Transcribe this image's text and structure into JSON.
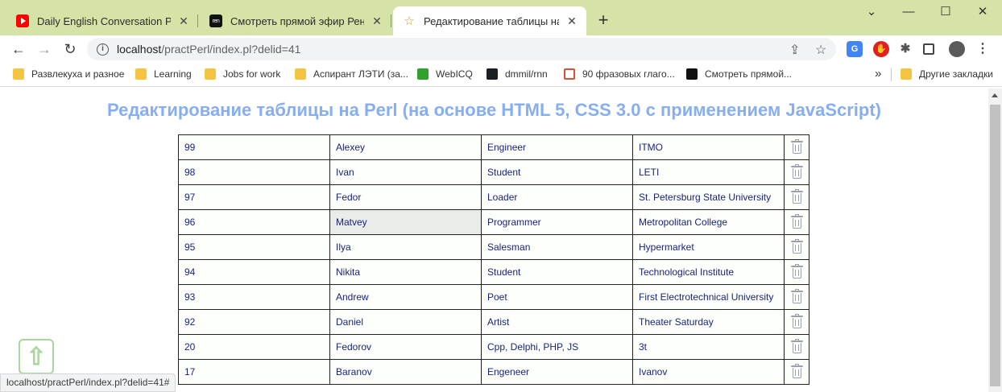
{
  "browser": {
    "tabs": [
      {
        "title": "Daily English Conversation Practice",
        "favicon": "youtube-icon",
        "active": false
      },
      {
        "title": "Смотреть прямой эфир РенТВ онлайн",
        "favicon": "rentv-icon",
        "favicon_text": "ren",
        "active": false
      },
      {
        "title": "Редактирование таблицы на Perl",
        "favicon": "star-icon",
        "active": true
      }
    ],
    "window_controls": {
      "chevron": "⌄",
      "minimize": "—",
      "maximize": "☐",
      "close": "✕"
    },
    "url": {
      "host": "localhost",
      "path": "/practPerl/index.pl?delid=41"
    },
    "bookmarks": [
      {
        "label": "Развлекуха и разное",
        "icon": "folder-icon"
      },
      {
        "label": "Learning",
        "icon": "folder-icon"
      },
      {
        "label": "Jobs for work",
        "icon": "folder-icon"
      },
      {
        "label": "Аспирант ЛЭТИ (за...",
        "icon": "folder-icon"
      },
      {
        "label": "WebICQ",
        "icon": "icq-icon"
      },
      {
        "label": "dmmil/rnn",
        "icon": "github-icon"
      },
      {
        "label": "90 фразовых глаго...",
        "icon": "phrasal-verbs-icon"
      },
      {
        "label": "Смотреть прямой...",
        "icon": "rentv-icon"
      }
    ],
    "bookmarks_more": "»",
    "other_bookmarks": "Другие закладки",
    "status_url": "localhost/practPerl/index.pl?delid=41#"
  },
  "page": {
    "title": "Редактирование таблицы на Perl (на основе HTML 5, CSS 3.0 с применением JavaScript)",
    "rows": [
      {
        "id": "99",
        "name": "Alexey",
        "job": "Engineer",
        "place": "ITMO"
      },
      {
        "id": "98",
        "name": "Ivan",
        "job": "Student",
        "place": "LETI"
      },
      {
        "id": "97",
        "name": "Fedor",
        "job": "Loader",
        "place": "St. Petersburg State University"
      },
      {
        "id": "96",
        "name": "Matvey",
        "job": "Programmer",
        "place": "Metropolitan College"
      },
      {
        "id": "95",
        "name": "Ilya",
        "job": "Salesman",
        "place": "Hypermarket"
      },
      {
        "id": "94",
        "name": "Nikita",
        "job": "Student",
        "place": "Technological Institute"
      },
      {
        "id": "93",
        "name": "Andrew",
        "job": "Poet",
        "place": "First Electrotechnical University"
      },
      {
        "id": "92",
        "name": "Daniel",
        "job": "Artist",
        "place": "Theater Saturday"
      },
      {
        "id": "20",
        "name": "Fedorov",
        "job": "Cpp, Delphi, PHP, JS",
        "place": "3t"
      },
      {
        "id": "17",
        "name": "Baranov",
        "job": "Engeneer",
        "place": "Ivanov"
      }
    ],
    "highlighted_cell": {
      "row": 3,
      "col": 1
    },
    "delete_icon": "trash-icon",
    "scroll_up_icon": "arrow-up-icon",
    "colors": {
      "title": "#86aef0",
      "cell_text": "#1a237e",
      "tabstrip": "#d5e3a6",
      "up_button": "#a8d69c"
    }
  }
}
